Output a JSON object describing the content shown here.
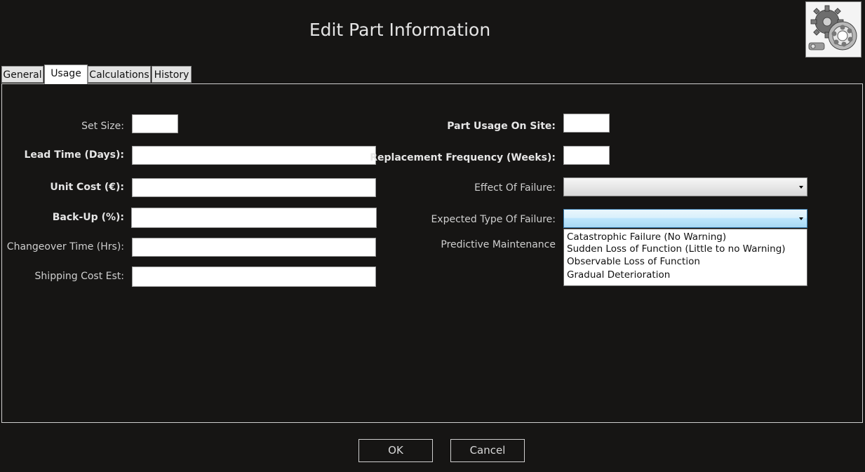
{
  "window": {
    "title": "Edit Part Information"
  },
  "logo": {
    "icon": "gears-bearing-logo"
  },
  "tabs": [
    {
      "label": "General",
      "active": false
    },
    {
      "label": "Usage",
      "active": true
    },
    {
      "label": "Calculations",
      "active": false
    },
    {
      "label": "History",
      "active": false
    }
  ],
  "left_fields": {
    "set_size": {
      "label": "Set Size:",
      "value": ""
    },
    "lead_time": {
      "label": "Lead Time (Days):",
      "value": ""
    },
    "unit_cost": {
      "label": "Unit Cost (€):",
      "value": ""
    },
    "backup": {
      "label": "Back-Up (%):",
      "value": ""
    },
    "changeover": {
      "label": "Changeover Time (Hrs):",
      "value": ""
    },
    "shipping": {
      "label": "Shipping Cost Est:",
      "value": ""
    }
  },
  "right_fields": {
    "usage_on_site": {
      "label": "Part Usage On Site:",
      "value": ""
    },
    "replacement_freq": {
      "label": "Replacement Frequency (Weeks):",
      "value": ""
    },
    "effect_of_failure": {
      "label": "Effect Of Failure:",
      "selected": ""
    },
    "expected_failure": {
      "label": "Expected Type Of Failure:",
      "selected": "",
      "options": [
        "Catastrophic Failure (No Warning)",
        "Sudden Loss of Function (Little to no Warning)",
        "Observable Loss of Function",
        "Gradual Deterioration"
      ]
    },
    "predictive": {
      "label": "Predictive Maintenance"
    }
  },
  "buttons": {
    "ok": "OK",
    "cancel": "Cancel"
  },
  "colors": {
    "background": "#161514",
    "combo_focus": "#a7d9f5"
  }
}
